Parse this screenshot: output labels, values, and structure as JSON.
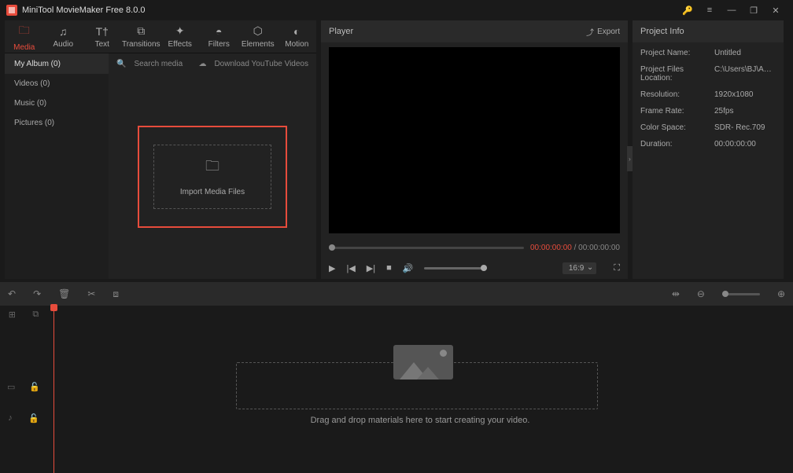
{
  "app": {
    "title": "MiniTool MovieMaker Free 8.0.0"
  },
  "tabs": [
    {
      "label": "Media"
    },
    {
      "label": "Audio"
    },
    {
      "label": "Text"
    },
    {
      "label": "Transitions"
    },
    {
      "label": "Effects"
    },
    {
      "label": "Filters"
    },
    {
      "label": "Elements"
    },
    {
      "label": "Motion"
    }
  ],
  "sidebar": {
    "items": [
      {
        "label": "My Album (0)"
      },
      {
        "label": "Videos (0)"
      },
      {
        "label": "Music (0)"
      },
      {
        "label": "Pictures (0)"
      }
    ]
  },
  "media": {
    "search_placeholder": "Search media",
    "download_label": "Download YouTube Videos",
    "import_label": "Import Media Files"
  },
  "player": {
    "title": "Player",
    "export_label": "Export",
    "time_current": "00:00:00:00",
    "time_total": " / 00:00:00:00",
    "ratio": "16:9"
  },
  "info": {
    "title": "Project Info",
    "rows": [
      {
        "label": "Project Name:",
        "value": "Untitled"
      },
      {
        "label": "Project Files Location:",
        "value": "C:\\Users\\BJ\\App..."
      },
      {
        "label": "Resolution:",
        "value": "1920x1080"
      },
      {
        "label": "Frame Rate:",
        "value": "25fps"
      },
      {
        "label": "Color Space:",
        "value": "SDR- Rec.709"
      },
      {
        "label": "Duration:",
        "value": "00:00:00:00"
      }
    ]
  },
  "timeline": {
    "drop_label": "Drag and drop materials here to start creating your video."
  }
}
